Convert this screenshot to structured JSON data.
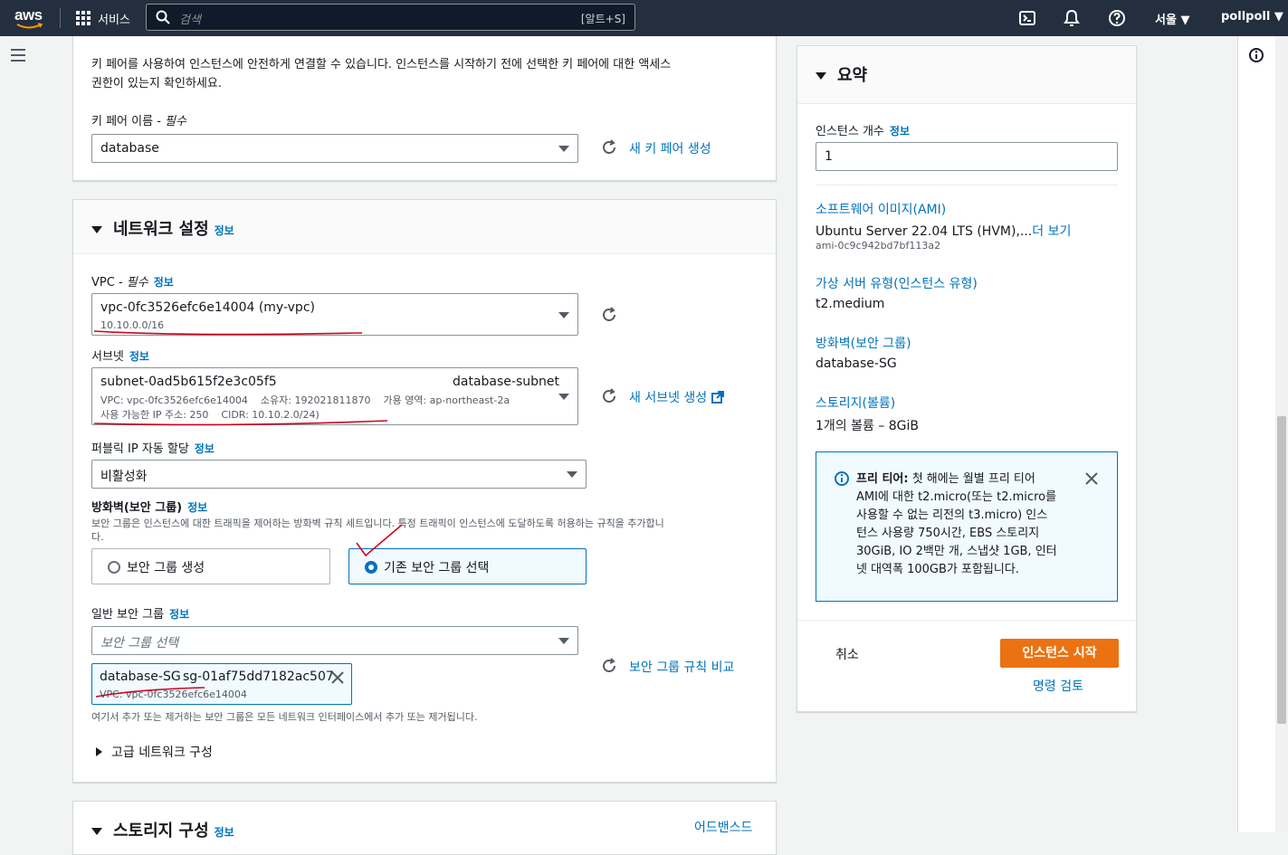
{
  "topnav": {
    "logo": "aws",
    "services_label": "서비스",
    "search_placeholder": "검색",
    "search_shortcut": "[알트+S]",
    "region": "서울 ▼",
    "account": "pollpoll ▼"
  },
  "keypair": {
    "description": "키 페어를 사용하여 인스턴스에 안전하게 연결할 수 있습니다. 인스턴스를 시작하기 전에 선택한 키 페어에 대한 액세스",
    "description2": "권한이 있는지 확인하세요.",
    "name_label": "키 페어 이름 - ",
    "required": "필수",
    "value": "database",
    "create_link": "새 키 페어 생성"
  },
  "network": {
    "title": "네트워크 설정",
    "info": "정보",
    "vpc_label": "VPC - ",
    "required": "필수",
    "vpc_value": "vpc-0fc3526efc6e14004 (my-vpc)",
    "vpc_cidr": "10.10.0.0/16",
    "subnet_label": "서브넷",
    "subnet_id": "subnet-0ad5b615f2e3c05f5",
    "subnet_name": "database-subnet",
    "subnet_detail1": "VPC: vpc-0fc3526efc6e14004    소유자: 192021811870    가용 영역: ap-northeast-2a",
    "subnet_detail2": "사용 가능한 IP 주소: 250    CIDR: 10.10.2.0/24)",
    "create_subnet_link": "새 서브넷 생성",
    "public_ip_label": "퍼블릭 IP 자동 할당",
    "public_ip_value": "비활성화",
    "firewall_label": "방화벽(보안 그룹)",
    "firewall_desc": "보안 그룹은 인스턴스에 대한 트래픽을 제어하는 방화벽 규칙 세트입니다. 특정 트래픽이 인스턴스에 도달하도록 허용하는 규칙을 추가합니",
    "firewall_desc2": "다.",
    "radio_create": "보안 그룹 생성",
    "radio_existing": "기존 보안 그룹 선택",
    "sg_label": "일반 보안 그룹",
    "sg_placeholder": "보안 그룹 선택",
    "sg_compare_link": "보안 그룹 규칙 비교",
    "token_name": "database-SG",
    "token_id": "sg-01af75dd7182ac507",
    "token_vpc": "VPC: vpc-0fc3526efc6e14004",
    "sg_note": "여기서 추가 또는 제거하는 보안 그룹은 모든 네트워크 인터페이스에서 추가 또는 제거됩니다.",
    "advanced": "고급 네트워크 구성"
  },
  "storage": {
    "title": "스토리지 구성",
    "info": "정보",
    "advanced_link": "어드밴스드"
  },
  "summary": {
    "title": "요약",
    "count_label": "인스턴스 개수",
    "info": "정보",
    "count_value": "1",
    "ami_link": "소프트웨어 이미지(AMI)",
    "ami_value": "Ubuntu Server 22.04 LTS (HVM),...",
    "ami_more": "더 보기",
    "ami_id": "ami-0c9c942bd7bf113a2",
    "type_link": "가상 서버 유형(인스턴스 유형)",
    "type_value": "t2.medium",
    "fw_link": "방화벽(보안 그룹)",
    "fw_value": "database-SG",
    "storage_link": "스토리지(볼륨)",
    "storage_value": "1개의 볼륨 – 8GiB",
    "free_tier_bold": "프리 티어:",
    "free_tier_lines": [
      " 첫 해에는 월별 프리 티어",
      "AMI에 대한 t2.micro(또는 t2.micro를",
      "사용할 수 없는 리전의 t3.micro) 인스",
      "턴스 사용량 750시간, EBS 스토리지",
      "30GiB, IO 2백만 개, 스냅샷 1GB, 인터",
      "넷 대역폭 100GB가 포함됩니다."
    ],
    "cancel": "취소",
    "launch": "인스턴스 시작",
    "review": "명령 검토"
  },
  "colors": {
    "nav": "#232f3e",
    "link": "#0073bb",
    "primary": "#ec7211",
    "annotation": "#d0021b"
  }
}
